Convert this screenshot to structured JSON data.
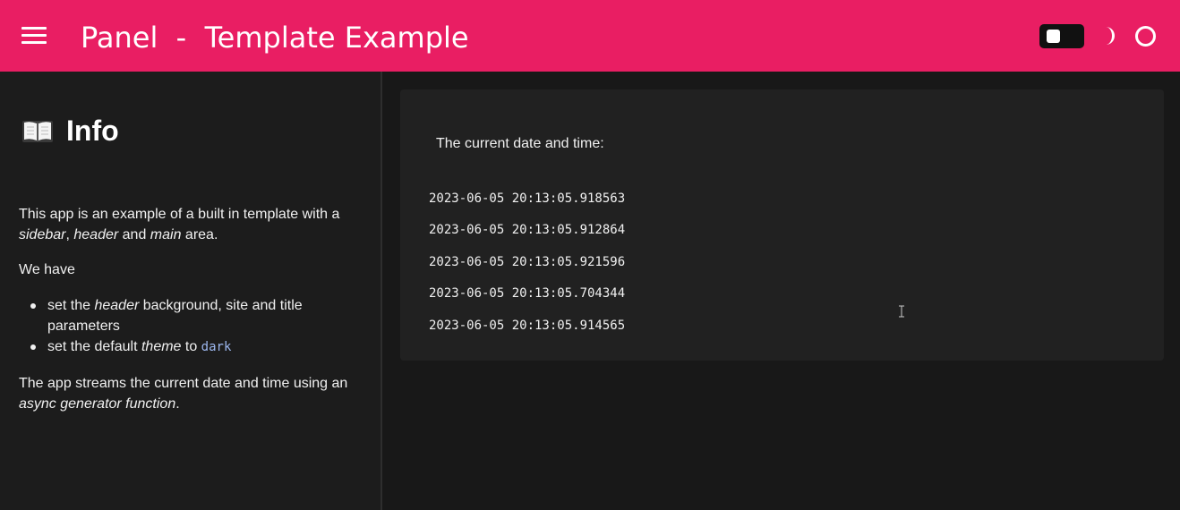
{
  "header": {
    "site_title": "Panel  -  Template Example",
    "background": "#e91e63",
    "icons": [
      "menu-icon",
      "theme-toggle",
      "moon-icon",
      "circle-icon"
    ]
  },
  "sidebar": {
    "heading": "Info",
    "heading_icon": "open-book-icon",
    "para1": {
      "text_a": "This app is an example of a built in template with a ",
      "em_sidebar": "sidebar",
      "sep": ", ",
      "em_header": "header",
      "and": " and ",
      "em_main": "main",
      "text_b": " area."
    },
    "para2": "We have",
    "list": [
      {
        "a": "set the ",
        "em": "header",
        "b": " background, site and title parameters"
      },
      {
        "a": "set the default ",
        "em": "theme",
        "b": " to ",
        "code": "dark"
      }
    ],
    "para3": {
      "text_a": "The app streams the current date and time using an ",
      "em": "async generator function",
      "text_b": "."
    }
  },
  "main": {
    "label": "The current date and time:",
    "timestamps": [
      "2023-06-05 20:13:05.918563",
      "2023-06-05 20:13:05.912864",
      "2023-06-05 20:13:05.921596",
      "2023-06-05 20:13:05.704344",
      "2023-06-05 20:13:05.914565"
    ]
  }
}
